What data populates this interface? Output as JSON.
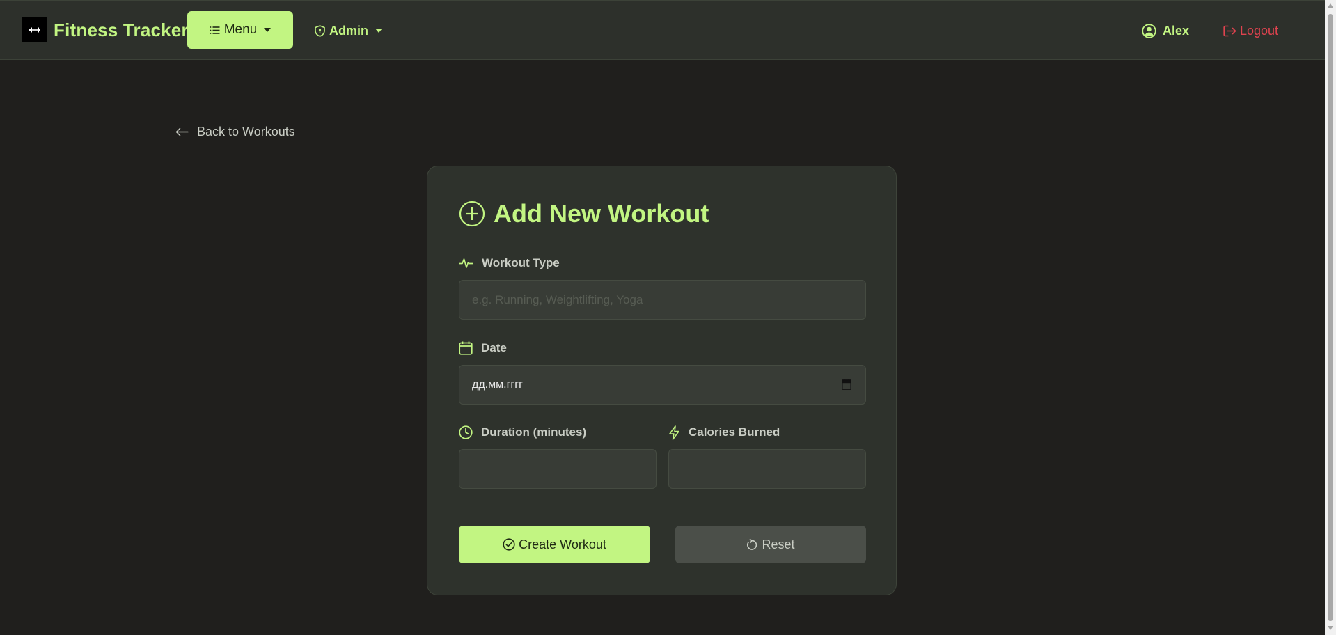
{
  "navbar": {
    "brand_icon": "dumbbell-icon",
    "brand_name": "Fitness Tracker",
    "menu_label": "Menu",
    "admin_label": "Admin",
    "user_name": "Alex",
    "logout_label": "Logout"
  },
  "back_link": {
    "label": "Back to Workouts"
  },
  "form": {
    "title": "Add New Workout",
    "workout_type": {
      "label": "Workout Type",
      "placeholder": "e.g. Running, Weightlifting, Yoga",
      "value": ""
    },
    "date": {
      "label": "Date",
      "value": "дд.мм.гггг"
    },
    "duration": {
      "label": "Duration (minutes)",
      "value": ""
    },
    "calories": {
      "label": "Calories Burned",
      "value": ""
    },
    "create_label": "Create Workout",
    "reset_label": "Reset"
  },
  "colors": {
    "accent": "#c2f582",
    "danger": "#e0434f",
    "background": "#201f1d",
    "card": "#2e322c"
  }
}
